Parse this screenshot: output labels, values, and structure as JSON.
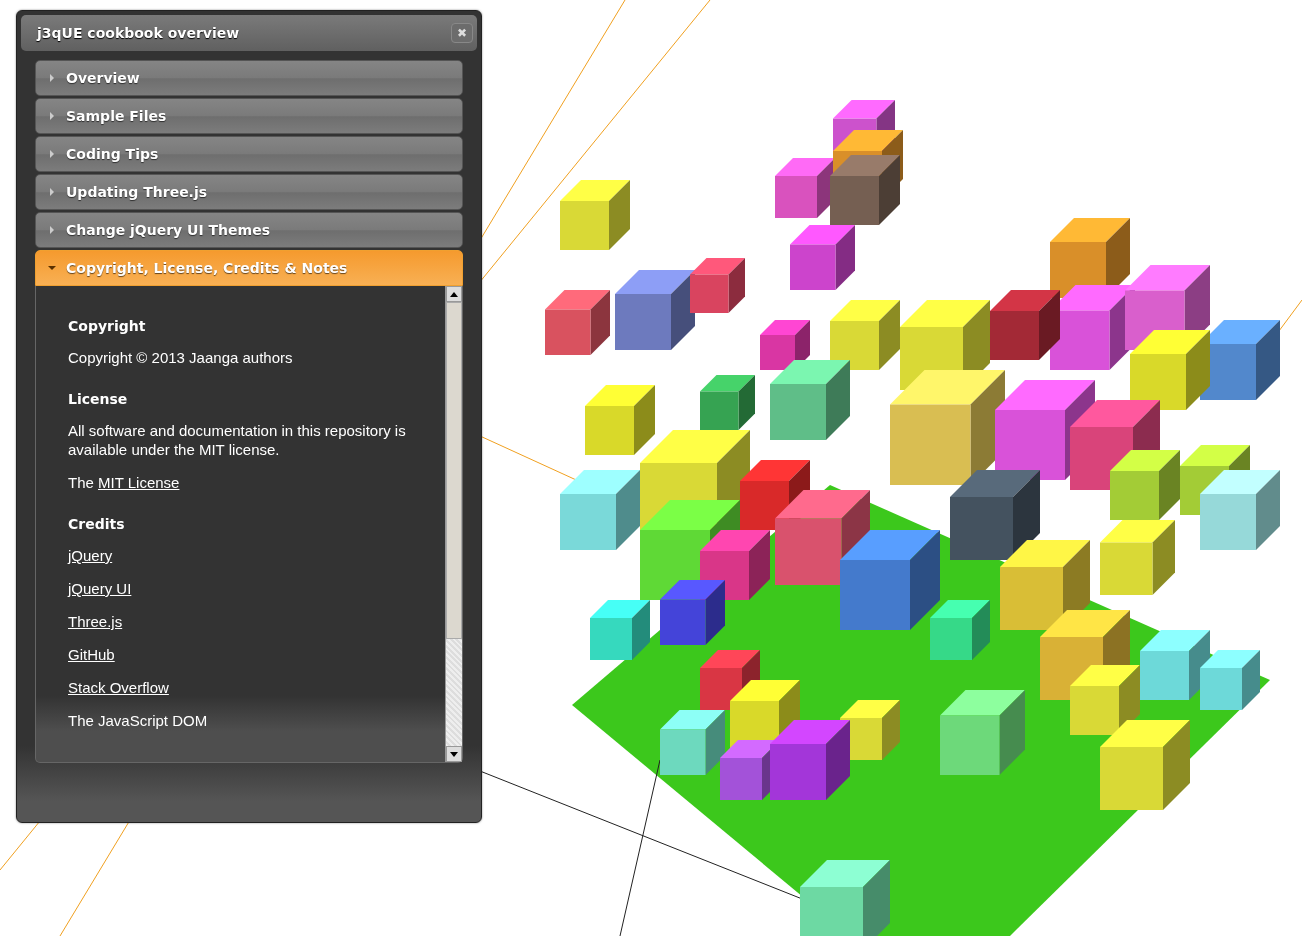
{
  "dialog": {
    "title": "j3qUE cookbook overview",
    "close_symbol": "✖"
  },
  "sections": [
    {
      "label": "Overview",
      "expanded": false
    },
    {
      "label": "Sample Files",
      "expanded": false
    },
    {
      "label": "Coding Tips",
      "expanded": false
    },
    {
      "label": "Updating Three.js",
      "expanded": false
    },
    {
      "label": "Change jQuery UI Themes",
      "expanded": false
    },
    {
      "label": "Copyright, License, Credits & Notes",
      "expanded": true
    }
  ],
  "content": [
    {
      "kind": "heading",
      "text": "Copyright"
    },
    {
      "kind": "paragraph",
      "text": "Copyright © 2013 Jaanga authors"
    },
    {
      "kind": "heading",
      "text": "License"
    },
    {
      "kind": "paragraph",
      "text": "All software and documentation in this repository is available under the MIT license."
    },
    {
      "kind": "mixed",
      "prefix": "The ",
      "link": "MIT License"
    },
    {
      "kind": "heading",
      "text": "Credits"
    },
    {
      "kind": "link",
      "text": "jQuery"
    },
    {
      "kind": "link",
      "text": "jQuery UI"
    },
    {
      "kind": "link",
      "text": "Three.js"
    },
    {
      "kind": "link",
      "text": "GitHub"
    },
    {
      "kind": "link",
      "text": "Stack Overflow"
    },
    {
      "kind": "paragraph",
      "text": "The JavaScript DOM"
    }
  ]
}
